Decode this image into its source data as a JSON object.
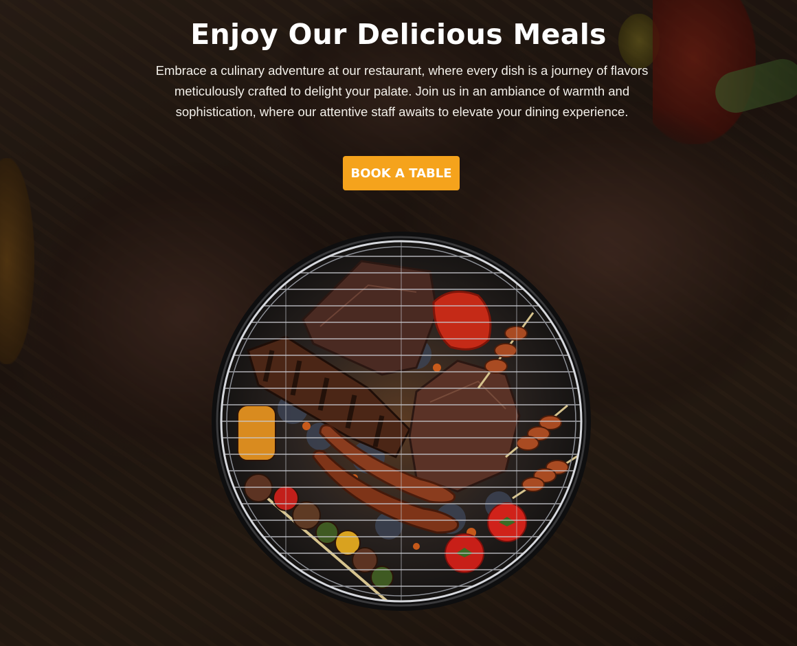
{
  "hero": {
    "title": "Enjoy Our Delicious Meals",
    "description": "Embrace a culinary adventure at our restaurant, where every dish is a journey of flavors meticulously crafted to delight your palate. Join us in an ambiance of warmth and sophistication, where our attentive staff awaits to elevate your dining experience.",
    "cta_label": "BOOK A TABLE"
  },
  "colors": {
    "accent": "#f5a31c",
    "text": "#ffffff"
  },
  "images": {
    "background": "grilled-steaks-on-wooden-board",
    "featured": "barbecue-grill-with-steaks-sausages-and-vegetable-skewers"
  }
}
